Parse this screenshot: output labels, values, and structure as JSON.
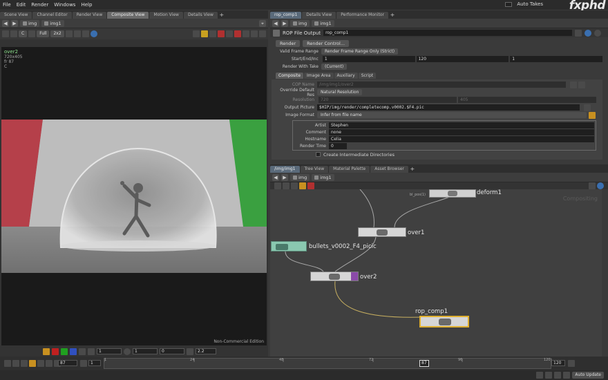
{
  "menu": [
    "File",
    "Edit",
    "Render",
    "Windows",
    "Help"
  ],
  "auto_takes": "Auto Takes",
  "logo": "fxphd",
  "left_tabs": [
    "Scene View",
    "Channel Editor",
    "Render View",
    "Composite View",
    "Motion View",
    "Details View"
  ],
  "left_path": {
    "context": "img",
    "node": "img1"
  },
  "viewer_toolbar": {
    "channel": "C",
    "resolution": "Full",
    "proxy": "2x2"
  },
  "viewer_info": {
    "name": "over2",
    "res": "720x405",
    "frame": "fr 87",
    "channel": "C"
  },
  "viewport_note": "Non-Commercial Edition",
  "viewer_status": {
    "v1": "1",
    "v2": "1",
    "v3": "0",
    "v4": "2.2"
  },
  "right_tabs": [
    "rop_comp1",
    "Details View",
    "Performance Monitor"
  ],
  "param_path": {
    "context": "img",
    "node": "img1"
  },
  "rop": {
    "type": "ROP File Output",
    "name": "rop_comp1"
  },
  "buttons": {
    "render": "Render",
    "render_control": "Render Control..."
  },
  "params": {
    "valid_frame_range_label": "Valid Frame Range",
    "valid_frame_range": "Render Frame Range Only (Strict)",
    "start_end_inc_label": "Start/End/Inc",
    "start": "1",
    "end": "120",
    "inc": "1",
    "render_with_take_label": "Render With Take",
    "render_with_take": "(Current)"
  },
  "param_tabs": [
    "Composite",
    "Image Area",
    "Auxiliary",
    "Script"
  ],
  "composite": {
    "cop_name_label": "COP Name",
    "cop_name": "/img/img1/over2",
    "override_label": "Override Default Res",
    "override": "Natural Resolution",
    "resolution_label": "Resolution",
    "res_x": "720",
    "res_y": "405",
    "output_picture_label": "Output Picture",
    "output_picture": "$HIP/img/render/completecomp.v0002.$F4.pic",
    "image_format_label": "Image Format",
    "image_format": "Infer from file name"
  },
  "meta": [
    {
      "label": "Artist",
      "value": "Stephen"
    },
    {
      "label": "Comment",
      "value": "none"
    },
    {
      "label": "Hostname",
      "value": "Celia"
    },
    {
      "label": "Render Time",
      "value": "0"
    }
  ],
  "create_dirs": "Create Intermediate Directories",
  "net_tabs": [
    "/img/img1",
    "Tree View",
    "Material Palette",
    "Asset Browser"
  ],
  "net_path": {
    "context": "img",
    "node": "img1"
  },
  "net_watermark": "Compositing",
  "nodes": {
    "deform": "deform1",
    "deform_small": "bl_pos(1)",
    "over1": "over1",
    "file": "bullets_v0002_F4_picic",
    "over2": "over2",
    "rop": "rop_comp1"
  },
  "timeline": {
    "current_frame": "87",
    "start": "1",
    "end": "120",
    "ticks": [
      "1",
      "24",
      "48",
      "72",
      "96",
      "120"
    ],
    "marker": "87"
  },
  "auto_update": "Auto Update"
}
